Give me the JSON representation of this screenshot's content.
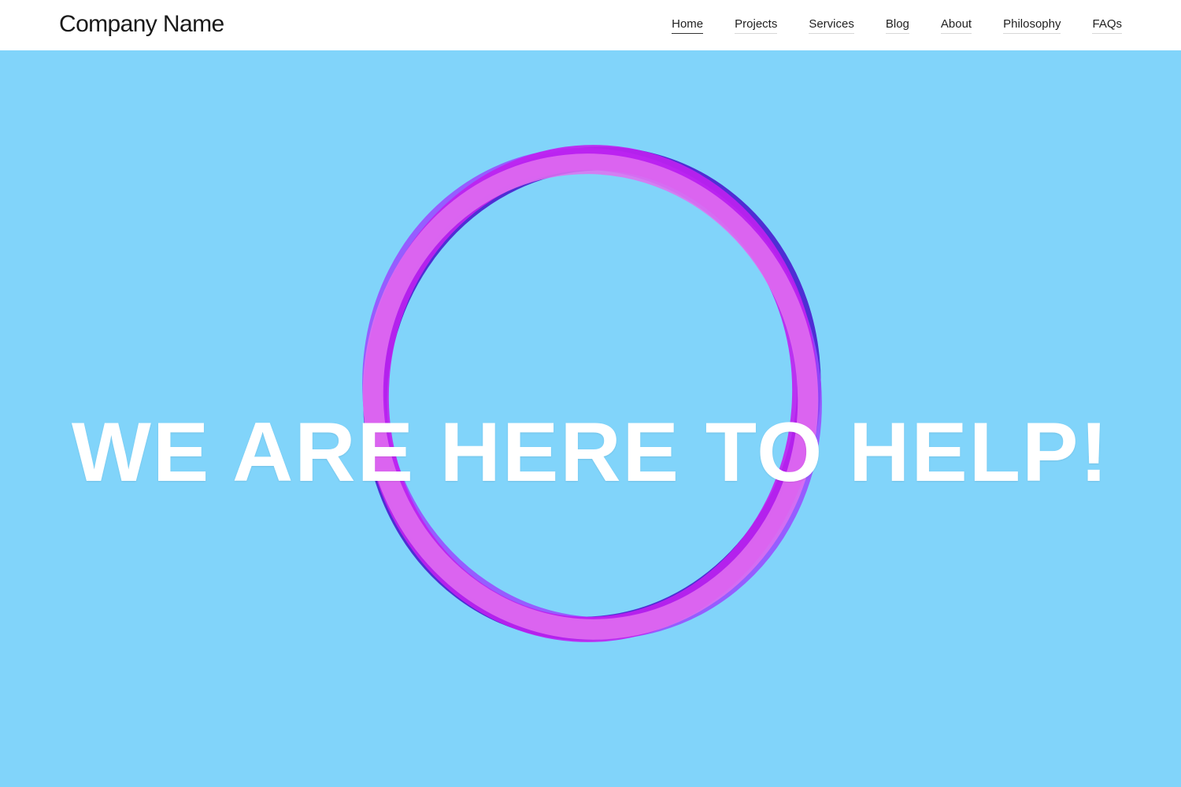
{
  "header": {
    "brand": "Company Name",
    "nav": [
      {
        "label": "Home",
        "active": true
      },
      {
        "label": "Projects",
        "active": false
      },
      {
        "label": "Services",
        "active": false
      },
      {
        "label": "Blog",
        "active": false
      },
      {
        "label": "About",
        "active": false
      },
      {
        "label": "Philosophy",
        "active": false
      },
      {
        "label": "FAQs",
        "active": false
      }
    ]
  },
  "hero": {
    "headline": "WE ARE HERE TO HELP!",
    "background_color": "#81d4fa",
    "ring_colors": [
      "#c020f0",
      "#4a1fd0",
      "#e070f0",
      "#9a48ff"
    ]
  }
}
